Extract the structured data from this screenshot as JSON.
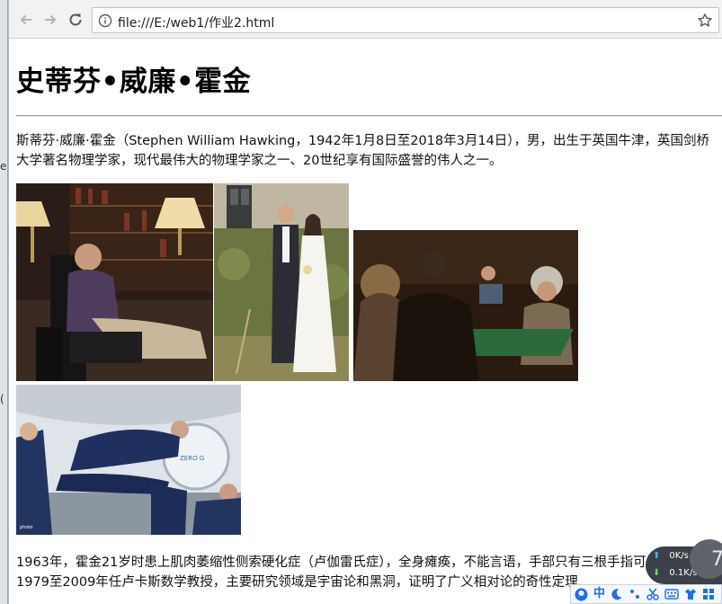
{
  "browser": {
    "url": "file:///E:/web1/作业2.html",
    "icons": [
      "back-arrow-icon",
      "forward-arrow-icon",
      "reload-icon",
      "info-icon",
      "star-icon"
    ]
  },
  "background_window": {
    "fragments": [
      "e",
      "("
    ]
  },
  "page": {
    "title": "史蒂芬•威廉•霍金",
    "intro": "斯蒂芬·威廉·霍金（Stephen William Hawking，1942年1月8日至2018年3月14日），男，出生于英国牛津，英国剑桥大学著名物理学家，现代最伟大的物理学家之一、20世纪享有国际盛誉的伟人之一。",
    "bio": "1963年，霍金21岁时患上肌肉萎缩性侧索硬化症（卢伽雷氏症），全身瘫痪，不能言语，手部只有三根手指可以活动。1979至2009年任卢卡斯数学教授，主要研究领域是宇宙论和黑洞，证明了广义相对论的奇性定理",
    "images": [
      {
        "subject": "man in wheelchair in library"
      },
      {
        "subject": "wedding couple"
      },
      {
        "subject": "card game scene"
      },
      {
        "subject": "zero gravity flight"
      }
    ]
  },
  "widget": {
    "upload_speed": "0K/s",
    "download_speed": "0.1K/s",
    "badge": "7"
  },
  "ime": {
    "items": [
      "中"
    ]
  }
}
